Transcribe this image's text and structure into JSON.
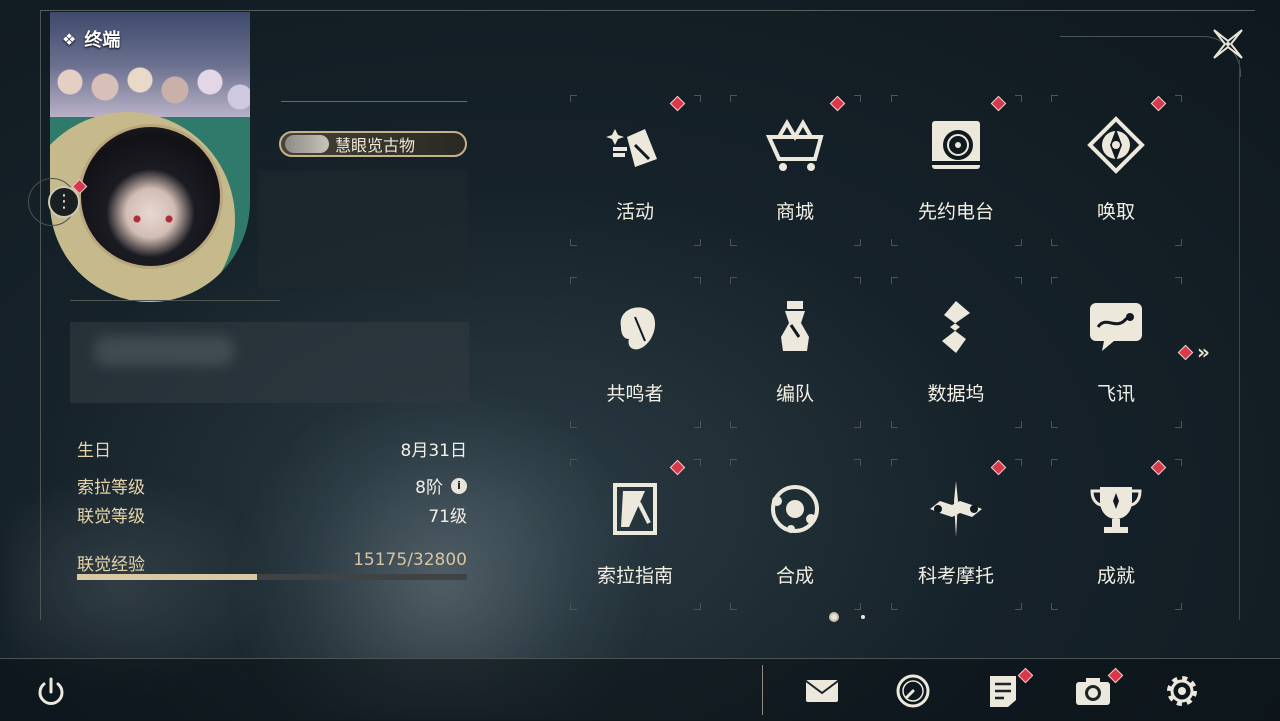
{
  "header": {
    "title": "终端"
  },
  "profile": {
    "title_badge": "慧眼览古物",
    "more_button": "⋮",
    "stats": {
      "birthday_label": "生日",
      "birthday_value": "8月31日",
      "sola_level_label": "索拉等级",
      "sola_level_value": "8阶",
      "union_level_label": "联觉等级",
      "union_level_value": "71级",
      "union_exp_label": "联觉经验",
      "union_exp_value": "15175/32800",
      "union_exp_fraction": 0.4626
    }
  },
  "grid": {
    "items": [
      {
        "label": "活动",
        "icon": "events-icon",
        "badge": true
      },
      {
        "label": "商城",
        "icon": "shop-icon",
        "badge": true
      },
      {
        "label": "先约电台",
        "icon": "radio-icon",
        "badge": true
      },
      {
        "label": "唤取",
        "icon": "convene-icon",
        "badge": true
      },
      {
        "label": "共鸣者",
        "icon": "resonator-icon",
        "badge": false
      },
      {
        "label": "编队",
        "icon": "team-icon",
        "badge": false
      },
      {
        "label": "数据坞",
        "icon": "data-bank-icon",
        "badge": false
      },
      {
        "label": "飞讯",
        "icon": "message-icon",
        "badge": false
      },
      {
        "label": "索拉指南",
        "icon": "guide-icon",
        "badge": true
      },
      {
        "label": "合成",
        "icon": "synthesis-icon",
        "badge": false
      },
      {
        "label": "科考摩托",
        "icon": "motorcycle-icon",
        "badge": true
      },
      {
        "label": "成就",
        "icon": "trophy-icon",
        "badge": true
      }
    ],
    "page_count": 2,
    "current_page": 1
  },
  "bottom_bar": {
    "icons": [
      "power-icon",
      "mail-icon",
      "clock-icon",
      "notice-icon",
      "camera-icon",
      "settings-icon"
    ]
  },
  "colors": {
    "accent_gold": "#c6b98c",
    "badge_red": "#d9384a",
    "avatar_ring": "#2f7a6a"
  }
}
